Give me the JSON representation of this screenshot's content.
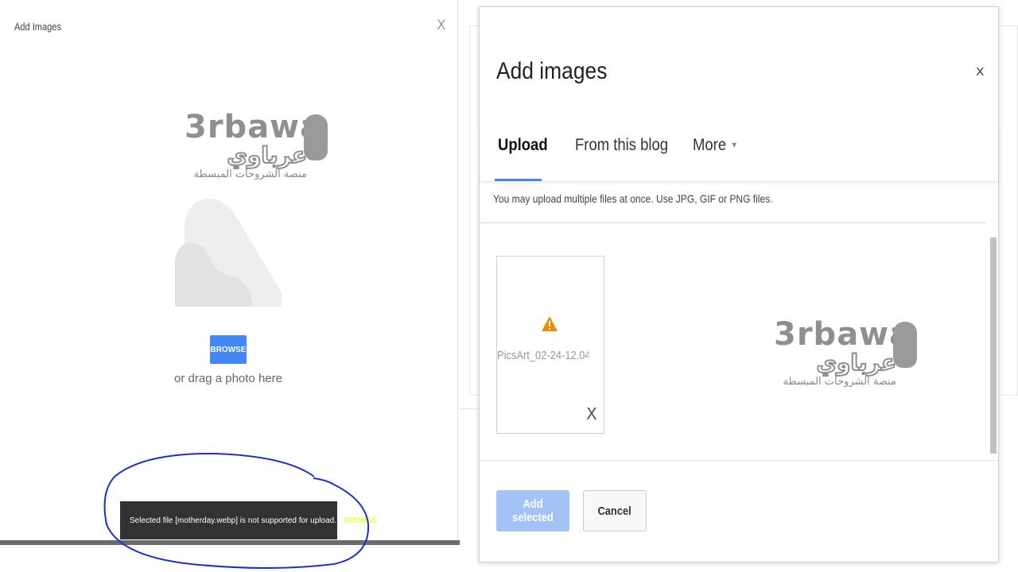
{
  "left_panel": {
    "title": "Add Images",
    "close_label": "X",
    "browse_label": "BROWSE",
    "drag_text": "or drag a photo here",
    "snackbar": {
      "message": "Selected file [motherday.webp] is not supported for upload.",
      "dismiss_label": "DISMISS"
    }
  },
  "watermark": {
    "latin": "3rbawa",
    "arabic": "عرباوي",
    "subtitle": "منصة الشروحات المبسطة"
  },
  "dialog": {
    "title": "Add images",
    "close_label": "x",
    "tabs": [
      {
        "label": "Upload",
        "active": true
      },
      {
        "label": "From this blog",
        "active": false
      },
      {
        "label": "More",
        "active": false
      }
    ],
    "hint": "You may upload multiple files at once. Use JPG, GIF or PNG files.",
    "file": {
      "name": "PicsArt_02-24-12.04....",
      "remove_label": "X",
      "icon": "warning-icon"
    },
    "buttons": {
      "add_selected": "Add selected",
      "cancel": "Cancel"
    }
  },
  "colors": {
    "accent": "#4285f4",
    "snackbar_bg": "#323232",
    "dismiss": "#eeff41",
    "warning": "#ef8c00",
    "annotation": "#1a2fd1"
  }
}
